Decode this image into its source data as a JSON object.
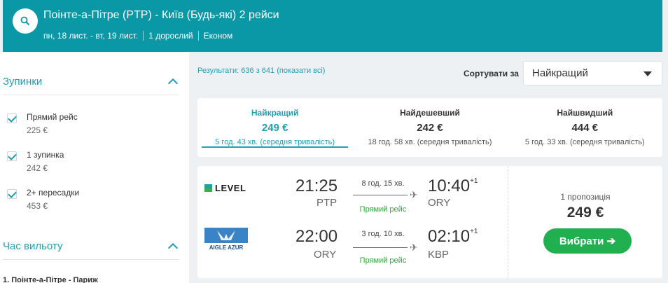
{
  "header": {
    "title": "Поінте-а-Пітре (PTP) - Київ (Будь-які) 2 рейси",
    "dates": "пн, 18 лист. - вт, 19 лист.",
    "passengers": "1 дорослий",
    "cabin": "Економ",
    "search_icon": "search-icon"
  },
  "sidebar": {
    "stops_title": "Зупинки",
    "stops": [
      {
        "label": "Прямий рейс",
        "price": "225 €",
        "checked": true
      },
      {
        "label": "1 зупинка",
        "price": "242 €",
        "checked": true
      },
      {
        "label": "2+ пересадки",
        "price": "453 €",
        "checked": true
      }
    ],
    "departure_title": "Час вильоту",
    "departure_segment": "1. Поінте-а-Пітре - Париж"
  },
  "results": {
    "summary": "Результати: 636 з 641 (показати всі)",
    "sort_label": "Сортувати за",
    "sort_value": "Найкращий"
  },
  "tabs": [
    {
      "name": "Найкращий",
      "price": "249 €",
      "duration": "5 год. 43 хв. (середня тривалість)",
      "active": true
    },
    {
      "name": "Найдешевший",
      "price": "242 €",
      "duration": "18 год. 58 хв. (середня тривалість)",
      "active": false
    },
    {
      "name": "Найшвидший",
      "price": "444 €",
      "duration": "5 год. 33 хв. (середня тривалість)",
      "active": false
    }
  ],
  "card": {
    "segments": [
      {
        "airline": "LEVEL",
        "dep_time": "21:25",
        "dep_code": "PTP",
        "duration": "8 год. 15 хв.",
        "stops": "Прямий рейс",
        "arr_time": "10:40",
        "arr_offset": "+1",
        "arr_code": "ORY"
      },
      {
        "airline": "AIGLE AZUR",
        "dep_time": "22:00",
        "dep_code": "ORY",
        "duration": "3 год. 10 хв.",
        "stops": "Прямий рейс",
        "arr_time": "02:10",
        "arr_offset": "+1",
        "arr_code": "KBP"
      }
    ],
    "offers": "1 пропозиція",
    "price": "249 €",
    "select_label": "Вибрати ➔"
  },
  "colors": {
    "header_bg": "#0a97a6",
    "accent": "#1fa0b3",
    "button": "#21b04f",
    "direct": "#2eaa3e"
  }
}
